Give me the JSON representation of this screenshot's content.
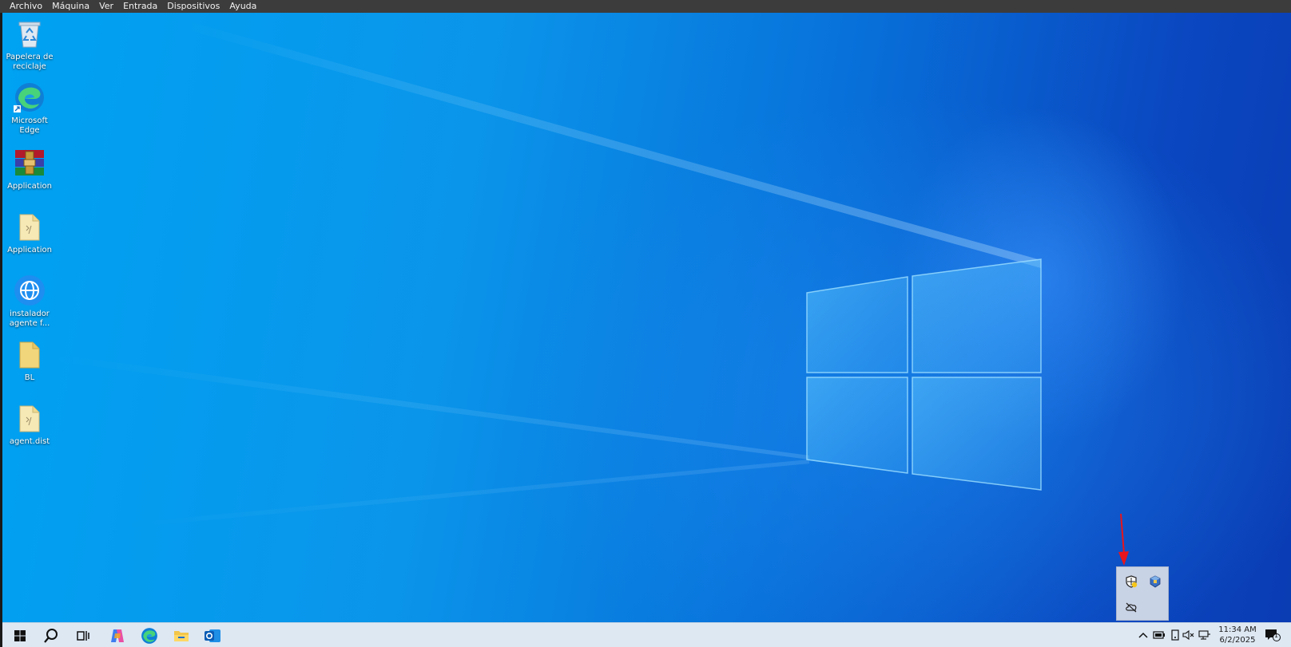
{
  "vm_menu": [
    "Archivo",
    "Máquina",
    "Ver",
    "Entrada",
    "Dispositivos",
    "Ayuda"
  ],
  "desktop_icons": [
    {
      "label": "Papelera de reciclaje",
      "icon": "recycle-bin-icon"
    },
    {
      "label": "Microsoft Edge",
      "icon": "edge-icon"
    },
    {
      "label": "Application",
      "icon": "winrar-icon"
    },
    {
      "label": "Application",
      "icon": "folder-icon"
    },
    {
      "label": "instalador agente f...",
      "icon": "globe-installer-icon"
    },
    {
      "label": "BL",
      "icon": "folder-icon"
    },
    {
      "label": "agent.dist",
      "icon": "folder-icon"
    }
  ],
  "taskbar": {
    "pinned": [
      "start-icon",
      "search-icon",
      "task-view-icon",
      "copilot-icon",
      "edge-icon",
      "file-explorer-icon",
      "outlook-icon"
    ],
    "tray_icons": [
      "chevron-up-icon",
      "battery-icon",
      "tablet-icon",
      "volume-muted-icon",
      "network-icon"
    ],
    "time": "11:34 AM",
    "date": "6/2/2025",
    "notifications_count": "1"
  },
  "tray_popup": {
    "icons": [
      "shield-warning-icon",
      "virtualbox-icon",
      "cloud-off-icon"
    ]
  },
  "colors": {
    "menubar": "#3c3c3c",
    "taskbar": "#dde8f3",
    "accent": "#0a78d7",
    "annotation": "#e8151b"
  }
}
